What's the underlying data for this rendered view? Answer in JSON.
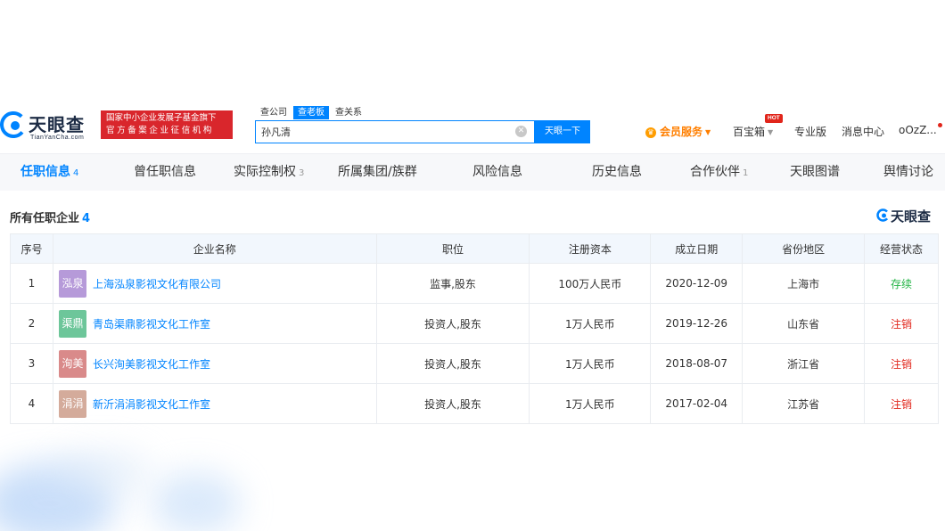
{
  "header": {
    "logo_cn": "天眼查",
    "logo_en": "TianYanCha.com",
    "badge_line1": "国家中小企业发展子基金旗下",
    "badge_line2": "官方备案企业征信机构",
    "search_tabs": [
      "查公司",
      "查老板",
      "查关系"
    ],
    "search_value": "孙凡清",
    "search_button": "天眼一下",
    "vip_label": "会员服务",
    "baibao_label": "百宝箱",
    "hot_badge": "HOT",
    "pro_label": "专业版",
    "message_label": "消息中心",
    "user_label": "oOzZ..."
  },
  "tabs": [
    {
      "label": "任职信息",
      "count": "4"
    },
    {
      "label": "曾任职信息",
      "count": ""
    },
    {
      "label": "实际控制权",
      "count": "3"
    },
    {
      "label": "所属集团/族群",
      "count": ""
    },
    {
      "label": "风险信息",
      "count": ""
    },
    {
      "label": "历史信息",
      "count": ""
    },
    {
      "label": "合作伙伴",
      "count": "1"
    },
    {
      "label": "天眼图谱",
      "count": ""
    },
    {
      "label": "舆情讨论",
      "count": ""
    }
  ],
  "section": {
    "title": "所有任职企业",
    "count": "4",
    "watermark": "天眼查"
  },
  "table": {
    "columns": [
      "序号",
      "企业名称",
      "职位",
      "注册资本",
      "成立日期",
      "省份地区",
      "经营状态"
    ],
    "rows": [
      {
        "index": "1",
        "logo_text": "泓泉",
        "logo_color": "#b69ad9",
        "name": "上海泓泉影视文化有限公司",
        "position": "监事,股东",
        "capital": "100万人民币",
        "date": "2020-12-09",
        "region": "上海市",
        "status": "存续",
        "status_color": "#23b445"
      },
      {
        "index": "2",
        "logo_text": "渠鼎",
        "logo_color": "#6dc69a",
        "name": "青岛渠鼎影视文化工作室",
        "position": "投资人,股东",
        "capital": "1万人民币",
        "date": "2019-12-26",
        "region": "山东省",
        "status": "注销",
        "status_color": "#e1251b"
      },
      {
        "index": "3",
        "logo_text": "洵美",
        "logo_color": "#d98a8a",
        "name": "长兴洵美影视文化工作室",
        "position": "投资人,股东",
        "capital": "1万人民币",
        "date": "2018-08-07",
        "region": "浙江省",
        "status": "注销",
        "status_color": "#e1251b"
      },
      {
        "index": "4",
        "logo_text": "涓涓",
        "logo_color": "#d4ab9b",
        "name": "新沂涓涓影视文化工作室",
        "position": "投资人,股东",
        "capital": "1万人民币",
        "date": "2017-02-04",
        "region": "江苏省",
        "status": "注销",
        "status_color": "#e1251b"
      }
    ]
  },
  "colors": {
    "accent": "#0084ff",
    "badge_red": "#d9262c",
    "vip_orange": "#ff7f00",
    "tab_bar_bg": "#f7f8fa",
    "table_header_bg": "#f2f7fd"
  }
}
